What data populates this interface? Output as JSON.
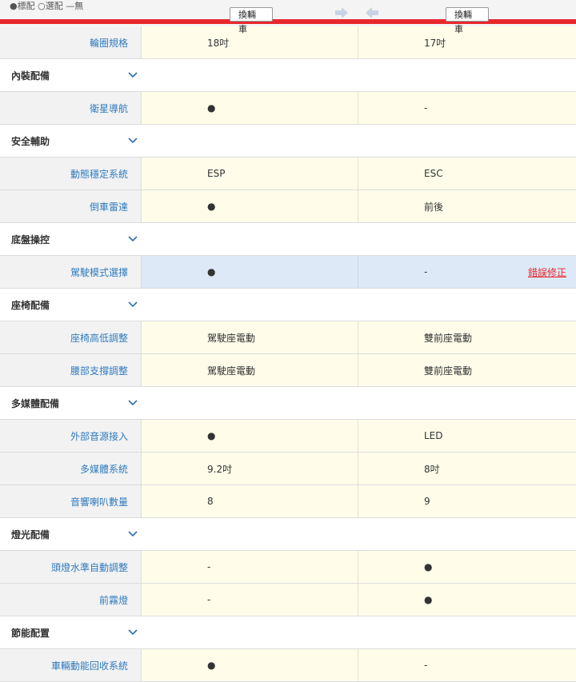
{
  "header": {
    "legend": "●標配 ○選配 —無",
    "swap_left": "換輛車",
    "swap_right": "換輛車"
  },
  "colors": {
    "accent_red": "#e8282d",
    "label_blue": "#2f7bbf",
    "cell_yellow": "#fffdea",
    "highlight_blue": "#dde9f7"
  },
  "rows": [
    {
      "kind": "row",
      "label": "輪圈規格",
      "a": "18吋",
      "b": "17吋"
    },
    {
      "kind": "section",
      "title": "內裝配備"
    },
    {
      "kind": "row",
      "label": "衛星導航",
      "a": "●",
      "b": "-"
    },
    {
      "kind": "section",
      "title": "安全輔助"
    },
    {
      "kind": "row",
      "label": "動態穩定系統",
      "a": "ESP",
      "b": "ESC"
    },
    {
      "kind": "row",
      "label": "倒車雷達",
      "a": "●",
      "b": "前後"
    },
    {
      "kind": "section",
      "title": "底盤操控"
    },
    {
      "kind": "row",
      "label": "駕駛模式選擇",
      "a": "●",
      "b": "-",
      "highlight": true,
      "action": "錯誤修正"
    },
    {
      "kind": "section",
      "title": "座椅配備"
    },
    {
      "kind": "row",
      "label": "座椅高低調整",
      "a": "駕駛座電動",
      "b": "雙前座電動"
    },
    {
      "kind": "row",
      "label": "腰部支撐調整",
      "a": "駕駛座電動",
      "b": "雙前座電動"
    },
    {
      "kind": "section",
      "title": "多媒體配備"
    },
    {
      "kind": "row",
      "label": "外部音源接入",
      "a": "●",
      "b": "LED"
    },
    {
      "kind": "row",
      "label": "多媒體系統",
      "a": "9.2吋",
      "b": "8吋"
    },
    {
      "kind": "row",
      "label": "音響喇叭數量",
      "a": "8",
      "b": "9"
    },
    {
      "kind": "section",
      "title": "燈光配備"
    },
    {
      "kind": "row",
      "label": "頭燈水準自動調整",
      "a": "-",
      "b": "●"
    },
    {
      "kind": "row",
      "label": "前霧燈",
      "a": "-",
      "b": "●"
    },
    {
      "kind": "section",
      "title": "節能配置"
    },
    {
      "kind": "row",
      "label": "車輛動能回收系統",
      "a": "●",
      "b": "-"
    }
  ]
}
